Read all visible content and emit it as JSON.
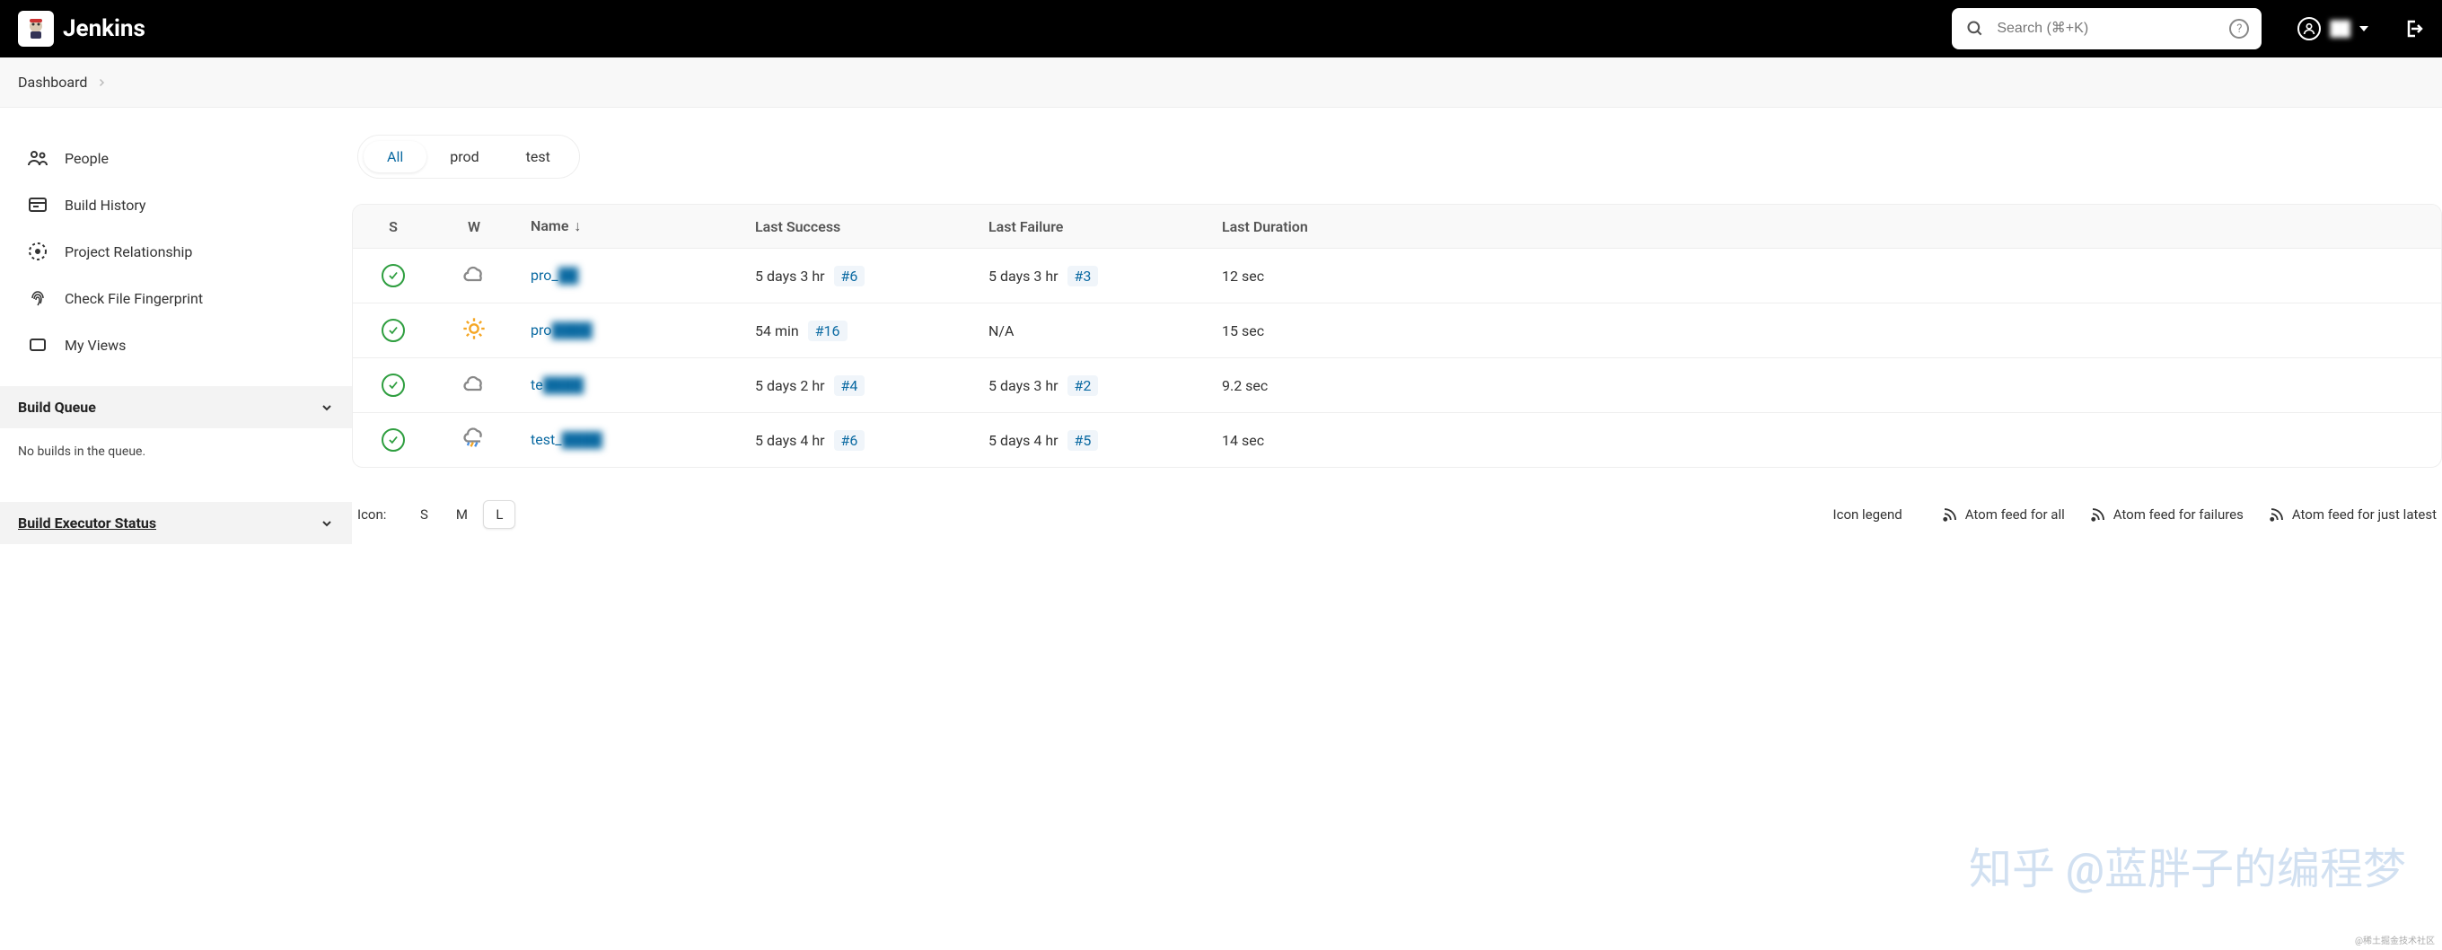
{
  "brand": "Jenkins",
  "search": {
    "placeholder": "Search (⌘+K)"
  },
  "user": {
    "name": "██"
  },
  "breadcrumb": [
    "Dashboard"
  ],
  "sidebar": {
    "items": [
      {
        "label": "People",
        "icon": "people-icon"
      },
      {
        "label": "Build History",
        "icon": "history-icon"
      },
      {
        "label": "Project Relationship",
        "icon": "relationship-icon"
      },
      {
        "label": "Check File Fingerprint",
        "icon": "fingerprint-icon"
      },
      {
        "label": "My Views",
        "icon": "views-icon"
      }
    ],
    "panels": {
      "queue": {
        "title": "Build Queue",
        "body": "No builds in the queue."
      },
      "executor": {
        "title": "Build Executor Status"
      }
    }
  },
  "tabs": [
    "All",
    "prod",
    "test"
  ],
  "active_tab": 0,
  "columns": {
    "s": "S",
    "w": "W",
    "name": "Name",
    "last_success": "Last Success",
    "last_failure": "Last Failure",
    "last_duration": "Last Duration"
  },
  "jobs": [
    {
      "status": "ok",
      "weather": "cloud",
      "name": "pro_██",
      "last_success": "5 days 3 hr",
      "last_success_build": "#6",
      "last_failure": "5 days 3 hr",
      "last_failure_build": "#3",
      "duration": "12 sec"
    },
    {
      "status": "ok",
      "weather": "sun",
      "name": "pro████",
      "last_success": "54 min",
      "last_success_build": "#16",
      "last_failure": "N/A",
      "last_failure_build": "",
      "duration": "15 sec"
    },
    {
      "status": "ok",
      "weather": "cloud",
      "name": "te████",
      "last_success": "5 days 2 hr",
      "last_success_build": "#4",
      "last_failure": "5 days 3 hr",
      "last_failure_build": "#2",
      "duration": "9.2 sec"
    },
    {
      "status": "ok",
      "weather": "storm",
      "name": "test_████",
      "last_success": "5 days 4 hr",
      "last_success_build": "#6",
      "last_failure": "5 days 4 hr",
      "last_failure_build": "#5",
      "duration": "14 sec"
    }
  ],
  "footer": {
    "icon_label": "Icon:",
    "sizes": [
      "S",
      "M",
      "L"
    ],
    "active_size": 2,
    "legend": "Icon legend",
    "feeds": [
      "Atom feed for all",
      "Atom feed for failures",
      "Atom feed for just latest"
    ]
  },
  "watermark": "知乎 @蓝胖子的编程梦",
  "attribution": "@稀土掘金技术社区"
}
